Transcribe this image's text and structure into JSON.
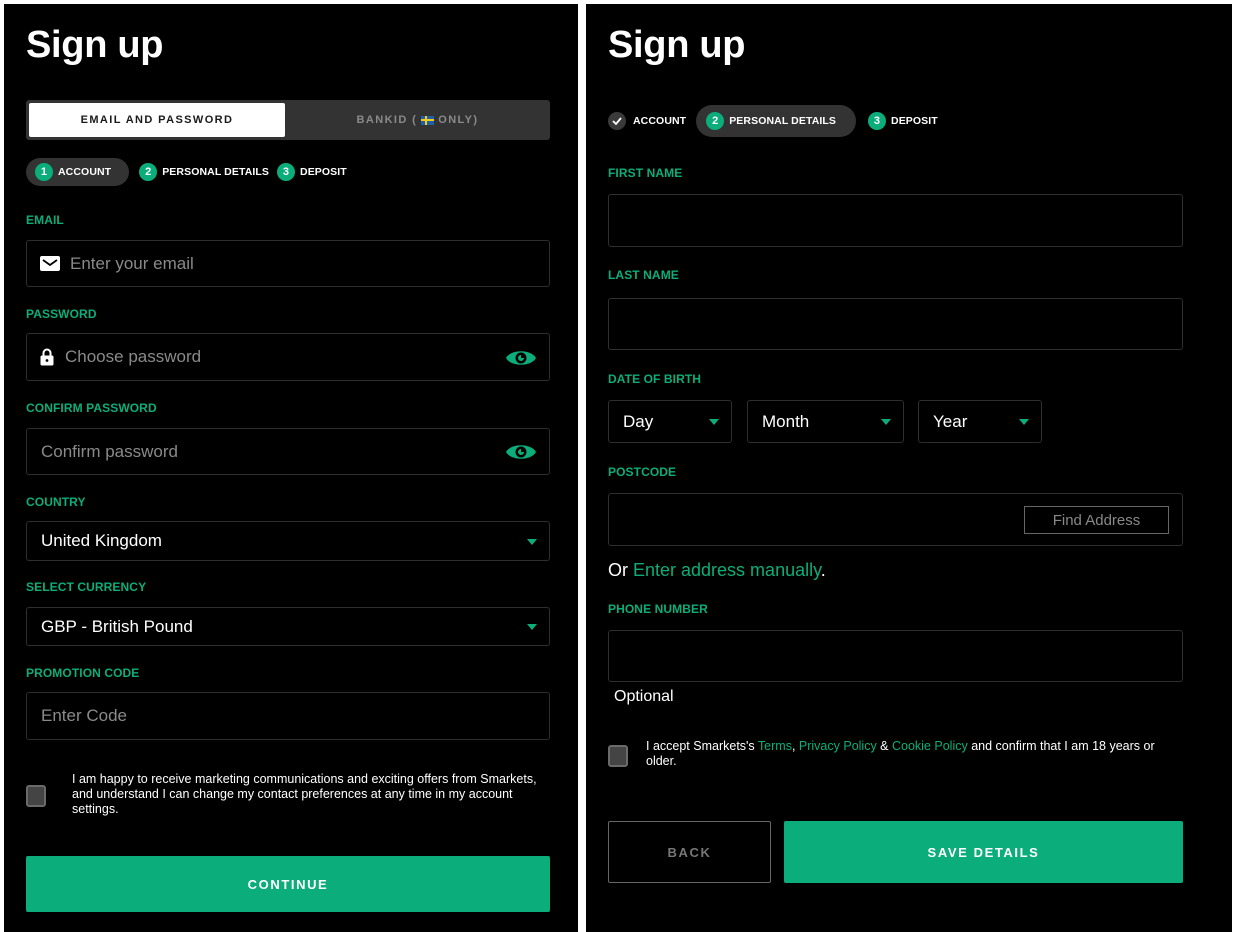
{
  "colors": {
    "accent": "#0bae7a",
    "background": "#000000",
    "surface": "#333333",
    "input_border": "#2e2e2e"
  },
  "left": {
    "title": "Sign up",
    "method_tabs": [
      {
        "label": "EMAIL AND PASSWORD",
        "active": true
      },
      {
        "label_prefix": "BANKID (",
        "flag_icon": "sweden-flag-icon",
        "label_suffix": " ONLY)",
        "active": false
      }
    ],
    "steps": [
      {
        "num": "1",
        "label": "ACCOUNT",
        "state": "active"
      },
      {
        "num": "2",
        "label": "PERSONAL DETAILS",
        "state": "pending"
      },
      {
        "num": "3",
        "label": "DEPOSIT",
        "state": "pending"
      }
    ],
    "email": {
      "label": "EMAIL",
      "placeholder": "Enter your email",
      "icon": "envelope-icon"
    },
    "password": {
      "label": "PASSWORD",
      "placeholder": "Choose password",
      "icon": "lock-icon",
      "toggle_icon": "eye-icon"
    },
    "confirm_password": {
      "label": "CONFIRM PASSWORD",
      "placeholder": "Confirm password",
      "toggle_icon": "eye-icon"
    },
    "country": {
      "label": "COUNTRY",
      "value": "United Kingdom"
    },
    "currency": {
      "label": "SELECT CURRENCY",
      "value": "GBP - British Pound"
    },
    "promo": {
      "label": "PROMOTION CODE",
      "placeholder": "Enter Code"
    },
    "marketing_consent": {
      "checked": false,
      "text": "I am happy to receive marketing communications and exciting offers from Smarkets, and understand I can change my contact preferences at any time in my account settings."
    },
    "continue_label": "CONTINUE"
  },
  "right": {
    "title": "Sign up",
    "steps": [
      {
        "icon": "check-icon",
        "label": "ACCOUNT",
        "state": "done"
      },
      {
        "num": "2",
        "label": "PERSONAL DETAILS",
        "state": "active"
      },
      {
        "num": "3",
        "label": "DEPOSIT",
        "state": "pending"
      }
    ],
    "first_name": {
      "label": "FIRST NAME",
      "value": ""
    },
    "last_name": {
      "label": "LAST NAME",
      "value": ""
    },
    "dob": {
      "label": "DATE OF BIRTH",
      "day": "Day",
      "month": "Month",
      "year": "Year"
    },
    "postcode": {
      "label": "POSTCODE",
      "value": "",
      "find_button": "Find Address"
    },
    "manual_address": {
      "prefix": "Or ",
      "link": "Enter address manually",
      "suffix": "."
    },
    "phone": {
      "label": "PHONE NUMBER",
      "value": "",
      "hint": "Optional"
    },
    "terms": {
      "checked": false,
      "t1": "I accept Smarkets's ",
      "terms_link": "Terms",
      "t2": ", ",
      "privacy_link": "Privacy Policy",
      "t3": " & ",
      "cookie_link": "Cookie Policy",
      "t4": " and confirm that I am 18 years or older."
    },
    "back_label": "BACK",
    "save_label": "SAVE DETAILS"
  }
}
